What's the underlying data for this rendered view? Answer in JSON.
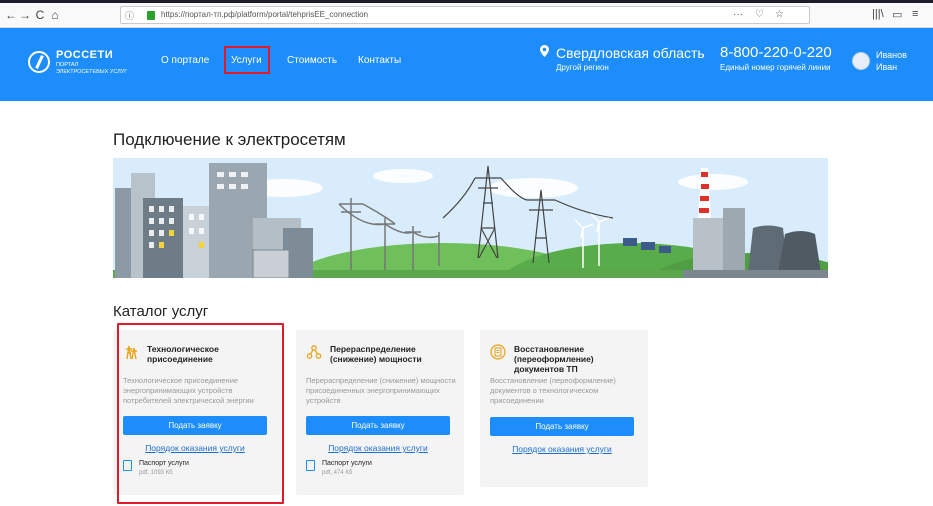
{
  "browser": {
    "url": "https://портал-тп.рф/platform/portal/tehprisEE_connection",
    "nav_back": "←",
    "nav_forward": "→",
    "nav_reload": "C",
    "nav_home": "⌂",
    "url_more": "···",
    "url_pocket": "♡",
    "url_star": "☆",
    "library": "|||\\",
    "sidebar": "▭",
    "more_menu": "≡"
  },
  "header": {
    "logo_brand": "РОССЕТИ",
    "logo_sub1": "ПОРТАЛ",
    "logo_sub2": "ЭЛЕКТРОСЕТЕВЫХ УСЛУГ",
    "menu": [
      "О портале",
      "Услуги",
      "Стоимость",
      "Контакты"
    ],
    "active_menu_index": 1,
    "region": "Свердловская область",
    "region_sub": "Другой регион",
    "phone": "8-800-220-0-220",
    "phone_sub": "Единый номер горячей линии",
    "user_last": "Иванов",
    "user_first": "Иван",
    "colors": {
      "header_bg": "#1c8dfa",
      "highlight": "#e01a2b"
    }
  },
  "page": {
    "title": "Подключение к электросетям",
    "catalog_title": "Каталог услуг"
  },
  "cards": [
    {
      "icon": "tower-icon",
      "title": "Технологическое присоединение",
      "desc": "Технологическое присоединение энергопринимающих устройств потребителей электрической энергии",
      "button": "Подать заявку",
      "link": "Порядок оказания услуги",
      "passport": "Паспорт услуги",
      "passport_meta": "pdf, 1093 Кб",
      "highlighted": true
    },
    {
      "icon": "redistribution-icon",
      "title": "Перераспределение (снижение) мощности",
      "desc": "Перераспределение (снижение) мощности присоединенных энергопринимающих устройств",
      "button": "Подать заявку",
      "link": "Порядок оказания услуги",
      "passport": "Паспорт услуги",
      "passport_meta": "pdf, 474 Кб",
      "highlighted": false
    },
    {
      "icon": "document-restore-icon",
      "title": "Восстановление (переоформление) документов ТП",
      "desc": "Восстановление (переоформление) документов о технологическом присоединении",
      "button": "Подать заявку",
      "link": "Порядок оказания услуги",
      "highlighted": false
    }
  ]
}
